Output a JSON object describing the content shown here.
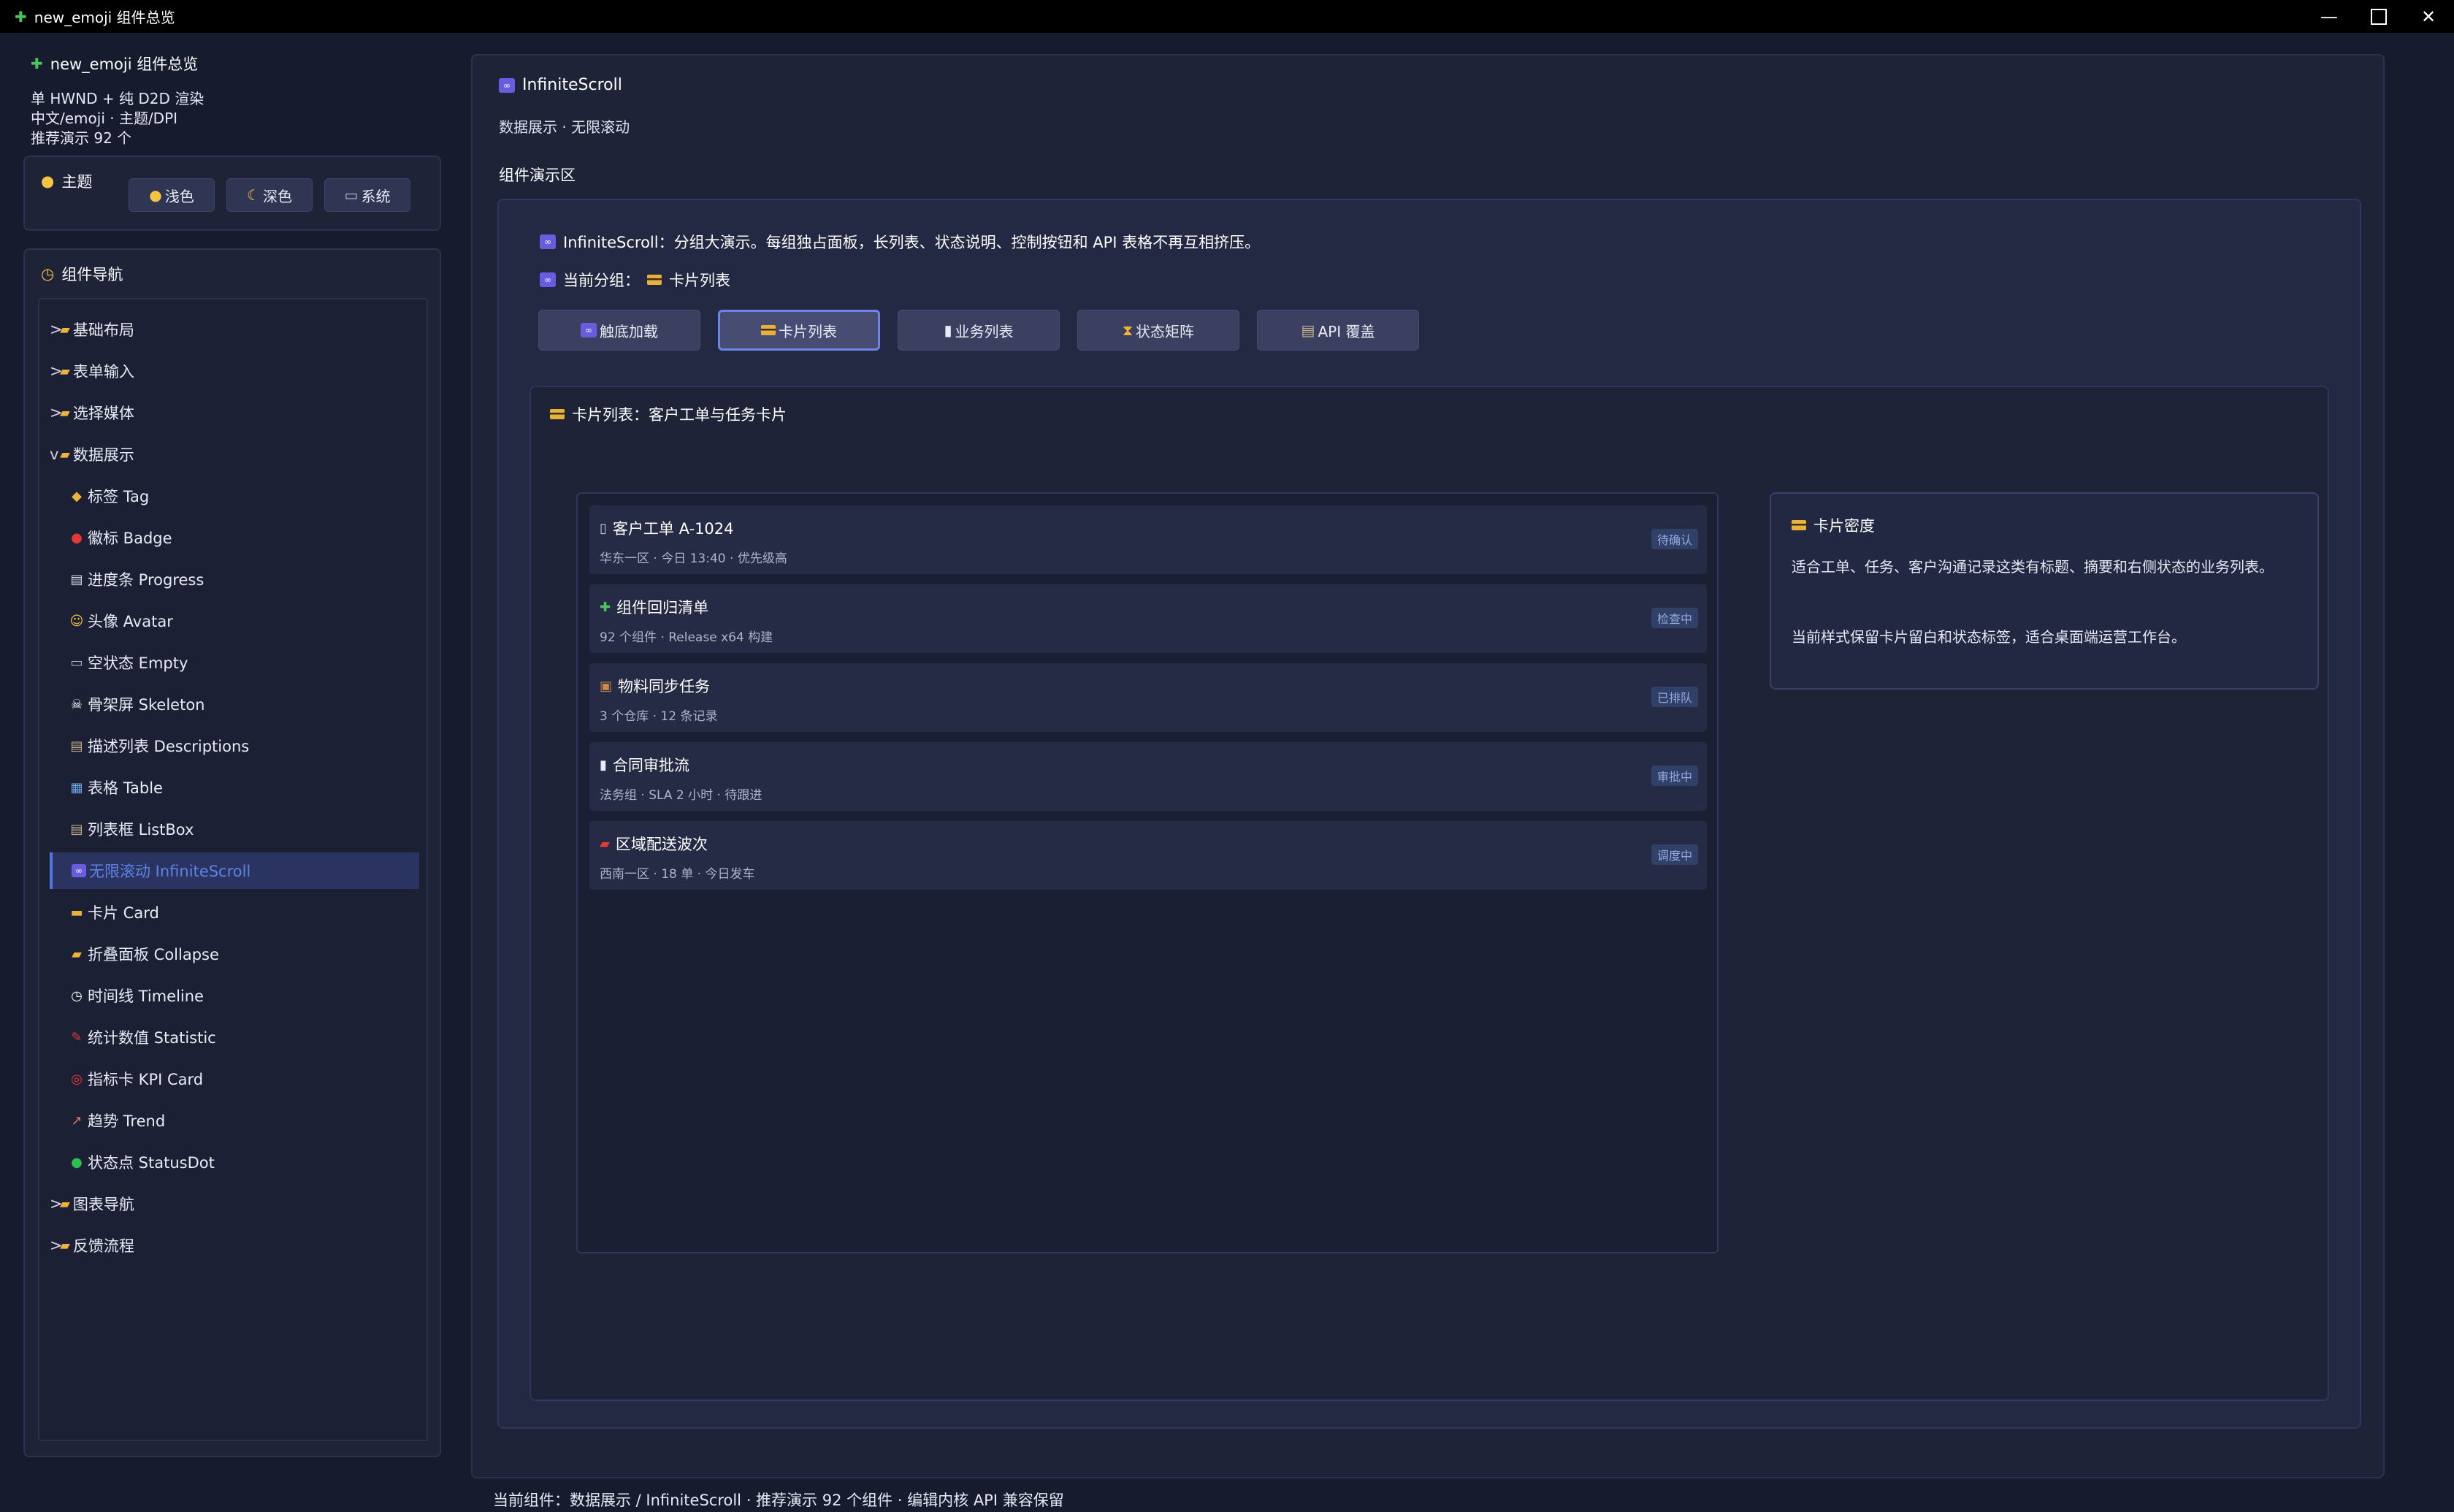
{
  "window": {
    "title": "new_emoji 组件总览",
    "icon": "puzzle-icon"
  },
  "colors": {
    "background": "#171b2e",
    "panel": "#1e2338",
    "accent": "#4f78e0",
    "status_tag": "#304067"
  },
  "sidebar": {
    "header": {
      "title": "new_emoji 组件总览",
      "lines": [
        "单 HWND + 纯 D2D 渲染",
        "中文/emoji · 主题/DPI",
        "推荐演示 92 个"
      ]
    },
    "theme": {
      "label": "主题",
      "buttons": [
        {
          "icon": "●",
          "label": "浅色"
        },
        {
          "icon": "☾",
          "label": "深色"
        },
        {
          "icon": "▭",
          "label": "系统"
        }
      ]
    },
    "nav": {
      "label": "组件导航",
      "items": [
        {
          "arrow": ">",
          "label": "基础布局"
        },
        {
          "arrow": ">",
          "label": "表单输入"
        },
        {
          "arrow": ">",
          "label": "选择媒体"
        },
        {
          "arrow": "v",
          "label": "数据展示"
        },
        {
          "label": "标签 Tag",
          "icon": "◆"
        },
        {
          "label": "徽标 Badge",
          "icon": "●"
        },
        {
          "label": "进度条 Progress",
          "icon": "▤"
        },
        {
          "label": "头像 Avatar",
          "icon": "☺"
        },
        {
          "label": "空状态 Empty",
          "icon": "▭"
        },
        {
          "label": "骨架屏 Skeleton",
          "icon": "☠"
        },
        {
          "label": "描述列表 Descriptions",
          "icon": "▤"
        },
        {
          "label": "表格 Table",
          "icon": "▦"
        },
        {
          "label": "列表框 ListBox",
          "icon": "▤"
        },
        {
          "label": "无限滚动 InfiniteScroll",
          "icon": "∞"
        },
        {
          "label": "卡片 Card",
          "icon": "▬"
        },
        {
          "label": "折叠面板 Collapse",
          "icon": "▰"
        },
        {
          "label": "时间线 Timeline",
          "icon": "◷"
        },
        {
          "label": "统计数值 Statistic",
          "icon": "✎"
        },
        {
          "label": "指标卡 KPI Card",
          "icon": "◎"
        },
        {
          "label": "趋势 Trend",
          "icon": "↗"
        },
        {
          "label": "状态点 StatusDot",
          "icon": "●"
        },
        {
          "arrow": ">",
          "label": "图表导航"
        },
        {
          "arrow": ">",
          "label": "反馈流程"
        }
      ]
    }
  },
  "main": {
    "title": "InfiniteScroll",
    "subtitle": "数据展示 · 无限滚动",
    "demo_label": "组件演示区",
    "intro": "InfiniteScroll：分组大演示。每组独占面板，长列表、状态说明、控制按钮和 API 表格不再互相挤压。",
    "group_prefix": "当前分组：",
    "group_name": "卡片列表",
    "tabs": [
      {
        "icon": "∞",
        "label": "触底加载"
      },
      {
        "icon": "▬",
        "label": "卡片列表"
      },
      {
        "icon": "▮",
        "label": "业务列表"
      },
      {
        "icon": "⧗",
        "label": "状态矩阵"
      },
      {
        "icon": "▤",
        "label": "API 覆盖"
      }
    ],
    "section_title": "卡片列表：客户工单与任务卡片",
    "cards": [
      {
        "icon": "▯",
        "title": "客户工单 A-1024",
        "sub": "华东一区 · 今日 13:40 · 优先级高",
        "status": "待确认"
      },
      {
        "icon": "✚",
        "title": "组件回归清单",
        "sub": "92 个组件 · Release x64 构建",
        "status": "检查中"
      },
      {
        "icon": "▣",
        "title": "物料同步任务",
        "sub": "3 个仓库 · 12 条记录",
        "status": "已排队"
      },
      {
        "icon": "▮",
        "title": "合同审批流",
        "sub": "法务组 · SLA 2 小时 · 待跟进",
        "status": "审批中"
      },
      {
        "icon": "▰",
        "title": "区域配送波次",
        "sub": "西南一区 · 18 单 · 今日发车",
        "status": "调度中"
      }
    ],
    "density": {
      "title": "卡片密度",
      "p1": "适合工单、任务、客户沟通记录这类有标题、摘要和右侧状态的业务列表。",
      "p2": "当前样式保留卡片留白和状态标签，适合桌面端运营工作台。"
    }
  },
  "statusbar": "当前组件：数据展示 / InfiniteScroll · 推荐演示 92 个组件 · 编辑内核 API 兼容保留"
}
